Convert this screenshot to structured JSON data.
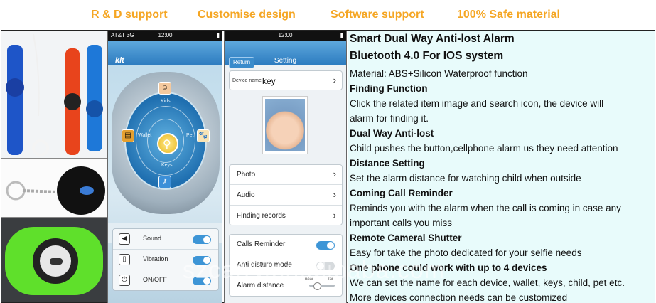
{
  "banner": {
    "items": [
      "R & D support",
      "Customise design",
      "Software support",
      "100% Safe material"
    ]
  },
  "colors": {
    "banner_text": "#f5a623",
    "text_panel_bg": "#e8fbfb",
    "app_blue": "#2d7cc0"
  },
  "screen1": {
    "status": {
      "carrier": "AT&T 3G",
      "time": "12:00"
    },
    "brand": "kit",
    "dial_labels": {
      "top": "Kids",
      "left": "Wallet",
      "right": "Pet",
      "bottom": "Keys"
    },
    "toggles": [
      {
        "label": "Sound",
        "on": true,
        "icon": "speaker-icon"
      },
      {
        "label": "Vibration",
        "on": true,
        "icon": "vibration-icon"
      },
      {
        "label": "ON/OFF",
        "on": true,
        "icon": "power-icon"
      }
    ]
  },
  "screen2": {
    "status": {
      "time": "12:00"
    },
    "back_label": "Return",
    "title": "Setting",
    "device_name_label": "Device name",
    "device_name_value": "key",
    "menu": [
      "Photo",
      "Audio",
      "Finding records"
    ],
    "settings": [
      {
        "label": "Calls Reminder",
        "type": "toggle",
        "on": true
      },
      {
        "label": "Anti disturb mode",
        "type": "toggle",
        "on": false
      },
      {
        "label": "Alarm distance",
        "type": "slider",
        "min_label": "near",
        "max_label": "far"
      }
    ]
  },
  "text_panel": {
    "title1": "Smart Dual Way Anti-lost Alarm",
    "title2": "Bluetooth 4.0 For IOS system",
    "material": "Material: ABS+Silicon  Waterproof function",
    "finding_head": "Finding Function",
    "finding_1": "Click the related item image and search icon, the device will",
    "finding_2": "alarm for finding it.",
    "dual_head": "Dual Way Anti-lost",
    "dual_1": "Child pushes the button,cellphone alarm us they need attention",
    "distance_head": "Distance Setting",
    "distance_1": "Set the alarm distance for watching child when outside",
    "call_head": "Coming Call Reminder",
    "call_1": "Reminds you with the alarm when the call is coming in case any",
    "call_2": "important calls you miss",
    "shutter_head": "Remote Cameral Shutter",
    "shutter_1": "Easy for take the photo dedicated for your selfie needs",
    "phone_head": "One phone could work with up to 4 devices",
    "phone_1": "We can set the name for each device, wallet, keys, child, pet etc.",
    "phone_2": "More devices connection needs can be customized"
  },
  "watermark": "szcarry.en.alibaba.com"
}
